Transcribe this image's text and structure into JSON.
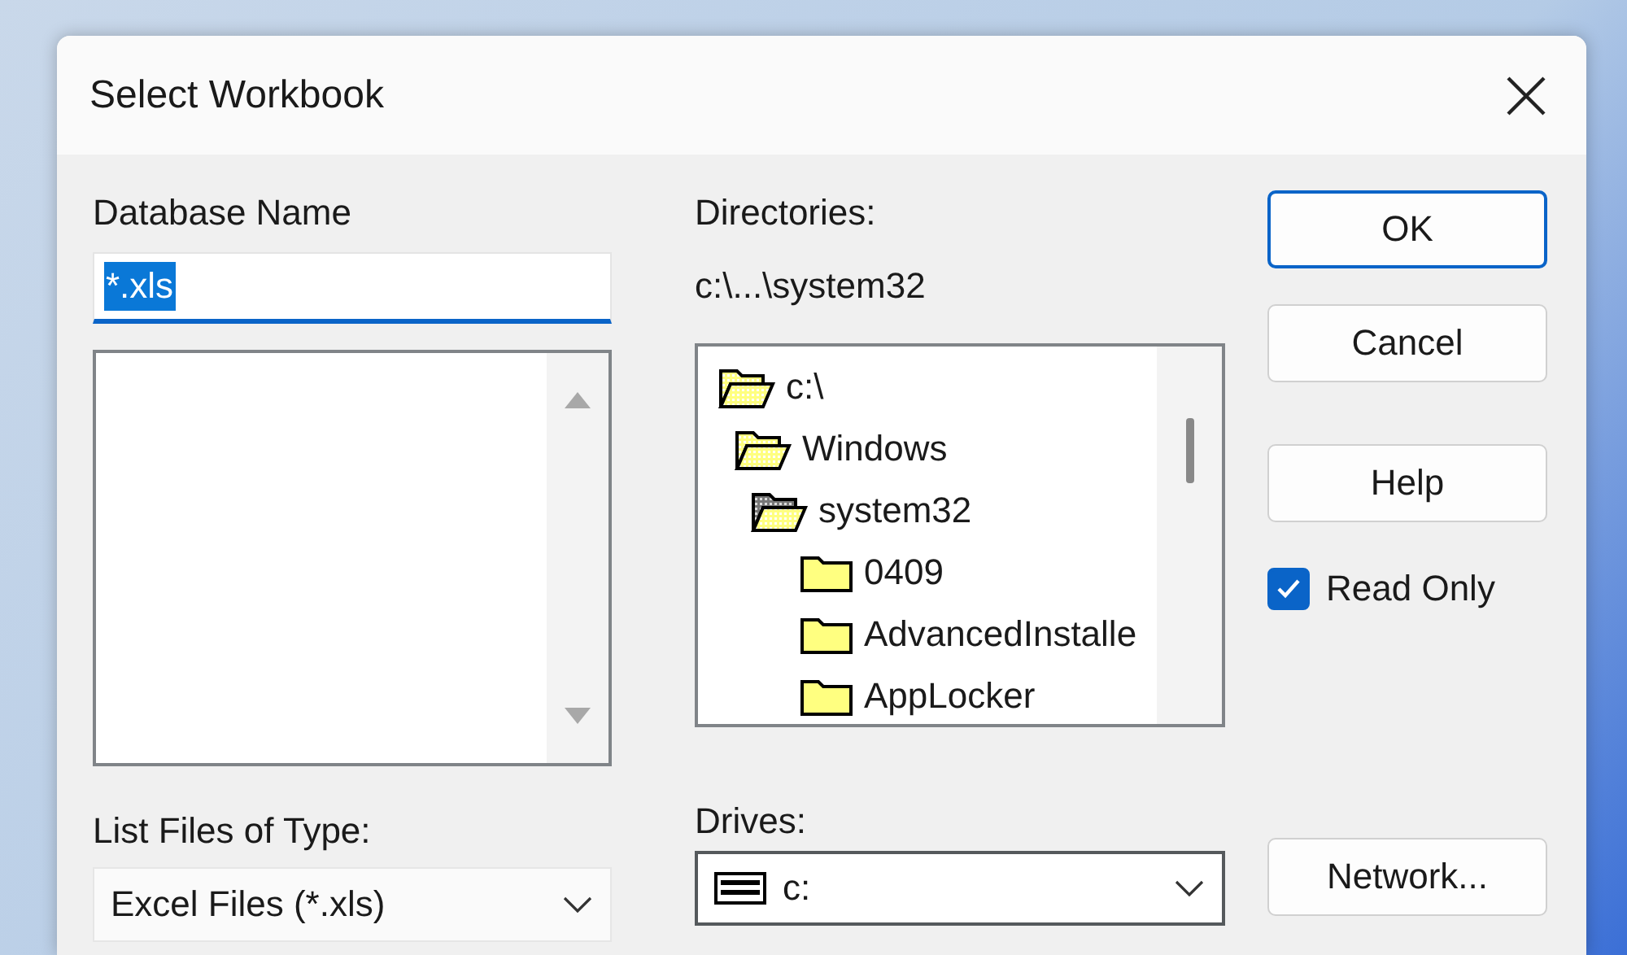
{
  "window": {
    "title": "Select Workbook"
  },
  "database_name": {
    "label": "Database Name",
    "value": "*.xls",
    "value_selected": true
  },
  "directories": {
    "label": "Directories:",
    "path": "c:\\...\\system32",
    "tree": [
      {
        "name": "c:\\",
        "current": false,
        "children": [
          {
            "name": "Windows",
            "current": false,
            "children": [
              {
                "name": "system32",
                "current": true,
                "children": [
                  {
                    "name": "0409",
                    "current": false
                  },
                  {
                    "name": "AdvancedInstalle",
                    "current": false
                  },
                  {
                    "name": "AppLocker",
                    "current": false
                  }
                ]
              }
            ]
          }
        ]
      }
    ]
  },
  "buttons": [
    {
      "label": "OK",
      "default": true
    },
    {
      "label": "Cancel",
      "default": false
    },
    {
      "label": "Help",
      "default": false
    }
  ],
  "read_only": {
    "label": "Read Only",
    "checked": true
  },
  "list_files_of_type": {
    "label": "List Files of Type:",
    "value": "Excel Files (*.xls)"
  },
  "drives": {
    "label": "Drives:",
    "value": "c:"
  },
  "network_button": {
    "label": "Network..."
  }
}
